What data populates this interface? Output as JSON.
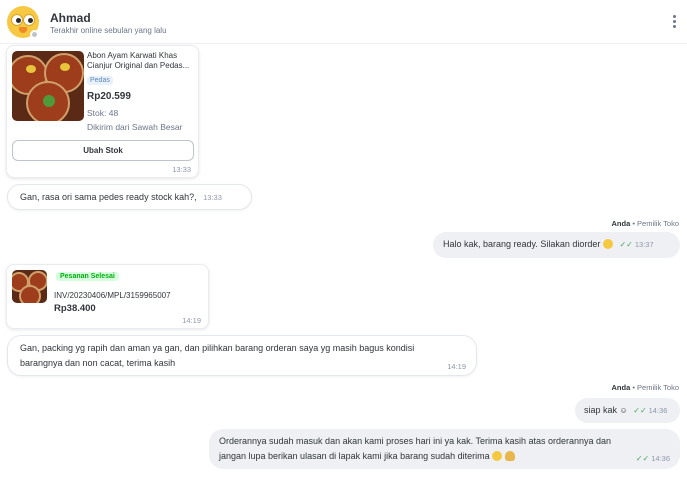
{
  "header": {
    "name": "Ahmad",
    "last_online": "Terakhir online sebulan yang lalu"
  },
  "product_card": {
    "title_line1": "Abon Ayam Karwati Khas",
    "title_line2": "Cianjur Original dan Pedas...",
    "variant": "Pedas",
    "price": "Rp20.599",
    "stock": "Stok: 48",
    "shipped_from": "Dikirim dari Sawah Besar",
    "button_label": "Ubah Stok",
    "time": "13:33"
  },
  "messages": {
    "m1": {
      "text": "Gan, rasa ori sama pedes ready stock kah?,",
      "time": "13:33"
    },
    "sender1": {
      "name": "Anda",
      "role": "• Pemilik Toko"
    },
    "m2": {
      "text": "Halo kak, barang ready. Silakan diorder",
      "time": "13:37"
    },
    "m3_line1": "Gan, packing yg rapih dan aman ya gan, dan pilihkan barang orderan saya yg masih bagus kondisi",
    "m3_line2": "barangnya dan non cacat, terima kasih",
    "m3_time": "14:19",
    "sender2": {
      "name": "Anda",
      "role": "• Pemilik Toko"
    },
    "m4": {
      "text": "siap kak",
      "time": "14:36"
    },
    "m5_line1": "Orderannya sudah masuk dan akan kami proses hari ini ya kak. Terima kasih atas orderannya dan",
    "m5_line2": "jangan lupa berikan ulasan di lapak kami jika barang sudah diterima",
    "m5_time": "14:36"
  },
  "order_card": {
    "status": "Pesanan Selesai",
    "invoice": "INV/20230406/MPL/3159965007",
    "total": "Rp38.400",
    "time": "14:19"
  },
  "colors": {
    "status_green": "#03ac0e",
    "status_green_bg": "#d6ffde",
    "read_check": "#4aa55c"
  },
  "icons": [
    "more-vertical-icon",
    "double-check-icon",
    "smile-emoji-icon",
    "pray-emoji-icon"
  ]
}
